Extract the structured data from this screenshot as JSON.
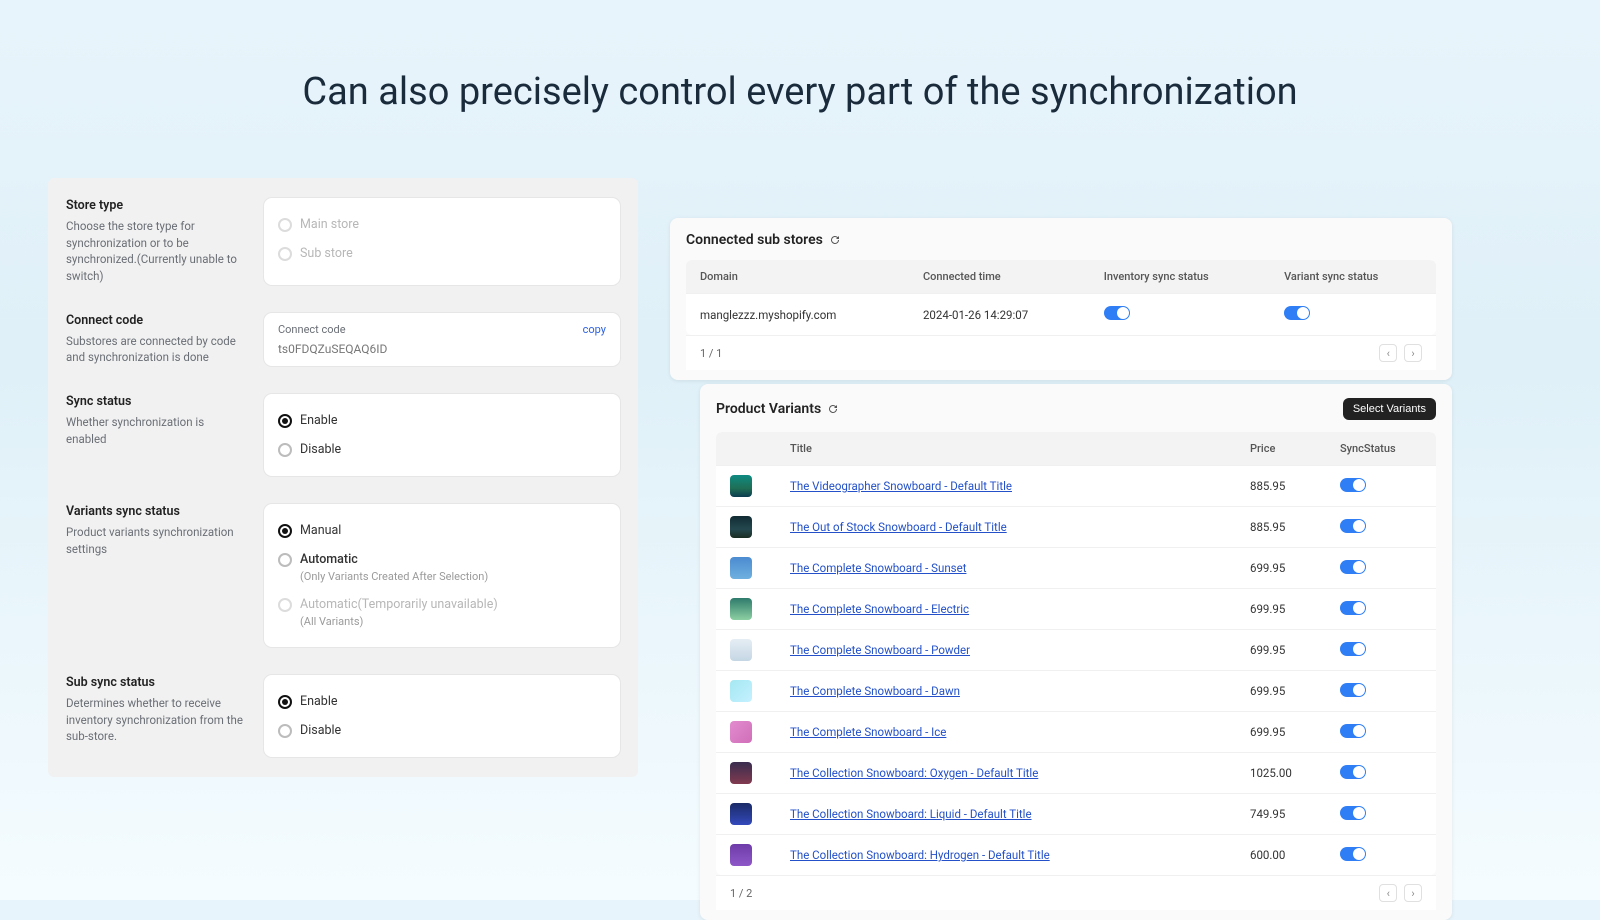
{
  "hero": {
    "title": "Can also precisely control every part of the synchronization"
  },
  "settings": {
    "store_type": {
      "title": "Store type",
      "desc": "Choose the store type for synchronization or to be synchronized.(Currently unable to switch)",
      "options": [
        "Main store",
        "Sub store"
      ]
    },
    "connect_code": {
      "title": "Connect code",
      "desc": "Substores are connected by code and synchronization is done",
      "label": "Connect code",
      "copy": "copy",
      "value": "ts0FDQZuSEQAQ6ID"
    },
    "sync_status": {
      "title": "Sync status",
      "desc": "Whether synchronization is enabled",
      "options": [
        "Enable",
        "Disable"
      ]
    },
    "variants_sync": {
      "title": "Variants sync status",
      "desc": "Product variants synchronization settings",
      "options": {
        "manual": "Manual",
        "auto": "Automatic",
        "auto_sub": "(Only Variants Created After Selection)",
        "auto_all": "Automatic(Temporarily unavailable)",
        "auto_all_sub": "(All Variants)"
      }
    },
    "sub_sync": {
      "title": "Sub sync status",
      "desc": "Determines whether to receive inventory synchronization from the sub-store.",
      "options": [
        "Enable",
        "Disable"
      ]
    }
  },
  "connected": {
    "title": "Connected sub stores",
    "columns": [
      "Domain",
      "Connected time",
      "Inventory sync status",
      "Variant sync status"
    ],
    "rows": [
      {
        "domain": "manglezzz.myshopify.com",
        "time": "2024-01-26 14:29:07"
      }
    ],
    "pager": "1 / 1"
  },
  "variants": {
    "title": "Product Variants",
    "button": "Select Variants",
    "columns": [
      "",
      "Title",
      "Price",
      "SyncStatus"
    ],
    "rows": [
      {
        "title": "The Videographer Snowboard - Default Title",
        "price": "885.95",
        "thumb": "linear-gradient(180deg,#0e8a82 0%, #1f6f55 60%, #0b3b4f 100%)"
      },
      {
        "title": "The Out of Stock Snowboard - Default Title",
        "price": "885.95",
        "thumb": "linear-gradient(180deg,#112b33 0%, #24484f 60%, #1a2c22 100%)"
      },
      {
        "title": "The Complete Snowboard - Sunset",
        "price": "699.95",
        "thumb": "linear-gradient(180deg,#4b8bd0,#6fb0df)"
      },
      {
        "title": "The Complete Snowboard - Electric",
        "price": "699.95",
        "thumb": "linear-gradient(180deg,#2e7b6c,#8ccfa2)"
      },
      {
        "title": "The Complete Snowboard - Powder",
        "price": "699.95",
        "thumb": "linear-gradient(180deg,#e6eef4,#c5d6e4)"
      },
      {
        "title": "The Complete Snowboard - Dawn",
        "price": "699.95",
        "thumb": "linear-gradient(135deg,#a4e8f2,#c5f0ff)"
      },
      {
        "title": "The Complete Snowboard - Ice",
        "price": "699.95",
        "thumb": "linear-gradient(135deg,#e38bcf,#d06fb9)"
      },
      {
        "title": "The Collection Snowboard: Oxygen - Default Title",
        "price": "1025.00",
        "thumb": "linear-gradient(180deg,#3a2d4f,#813a4f)"
      },
      {
        "title": "The Collection Snowboard: Liquid - Default Title",
        "price": "749.95",
        "thumb": "linear-gradient(180deg,#1a2a66,#3349bb)"
      },
      {
        "title": "The Collection Snowboard: Hydrogen - Default Title",
        "price": "600.00",
        "thumb": "linear-gradient(180deg,#6e3ca8,#8e57c8)"
      }
    ],
    "pager": "1 / 2"
  }
}
